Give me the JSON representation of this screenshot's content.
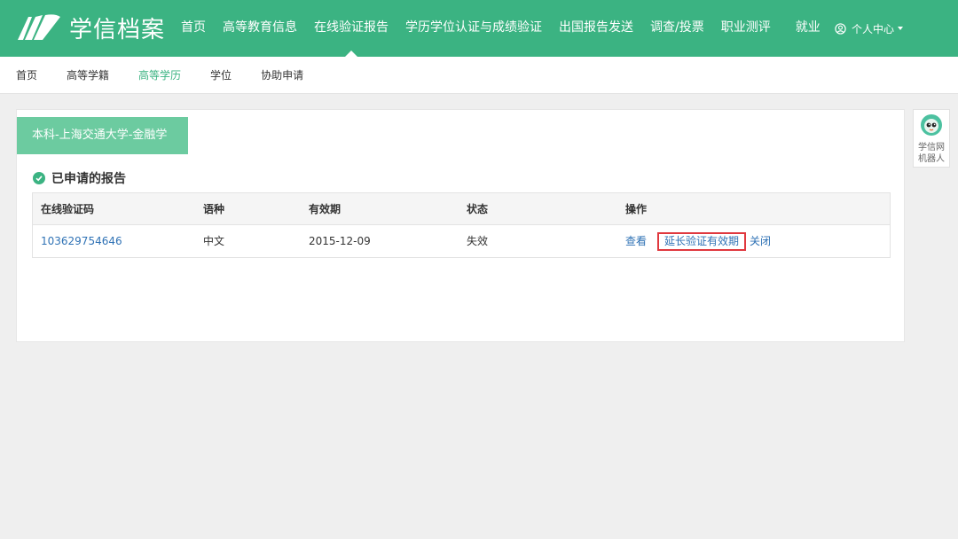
{
  "header": {
    "logo_text": "学信档案",
    "nav": [
      {
        "label": "首页"
      },
      {
        "label": "高等教育信息"
      },
      {
        "label": "在线验证报告",
        "active": true
      },
      {
        "label": "学历学位认证与成绩验证"
      },
      {
        "label": "出国报告发送"
      },
      {
        "label": "调查/投票"
      },
      {
        "label": "职业测评"
      },
      {
        "label": "就业"
      }
    ],
    "user_center": "个人中心"
  },
  "subnav": [
    {
      "label": "首页"
    },
    {
      "label": "高等学籍"
    },
    {
      "label": "高等学历",
      "active": true
    },
    {
      "label": "学位"
    },
    {
      "label": "协助申请"
    }
  ],
  "main": {
    "school_tab": "本科-上海交通大学-金融学",
    "section_title": "已申请的报告",
    "table": {
      "headers": [
        "在线验证码",
        "语种",
        "有效期",
        "状态",
        "操作"
      ],
      "rows": [
        {
          "code": "103629754646",
          "language": "中文",
          "validity": "2015-12-09",
          "status": "失效",
          "actions": [
            "查看",
            "延长验证有效期",
            "关闭"
          ]
        }
      ]
    }
  },
  "robot": {
    "line1": "学信网",
    "line2": "机器人"
  },
  "colors": {
    "brand": "#3bb382",
    "tab": "#6ccba0",
    "link": "#2f72b5",
    "highlight": "#e0383e"
  }
}
